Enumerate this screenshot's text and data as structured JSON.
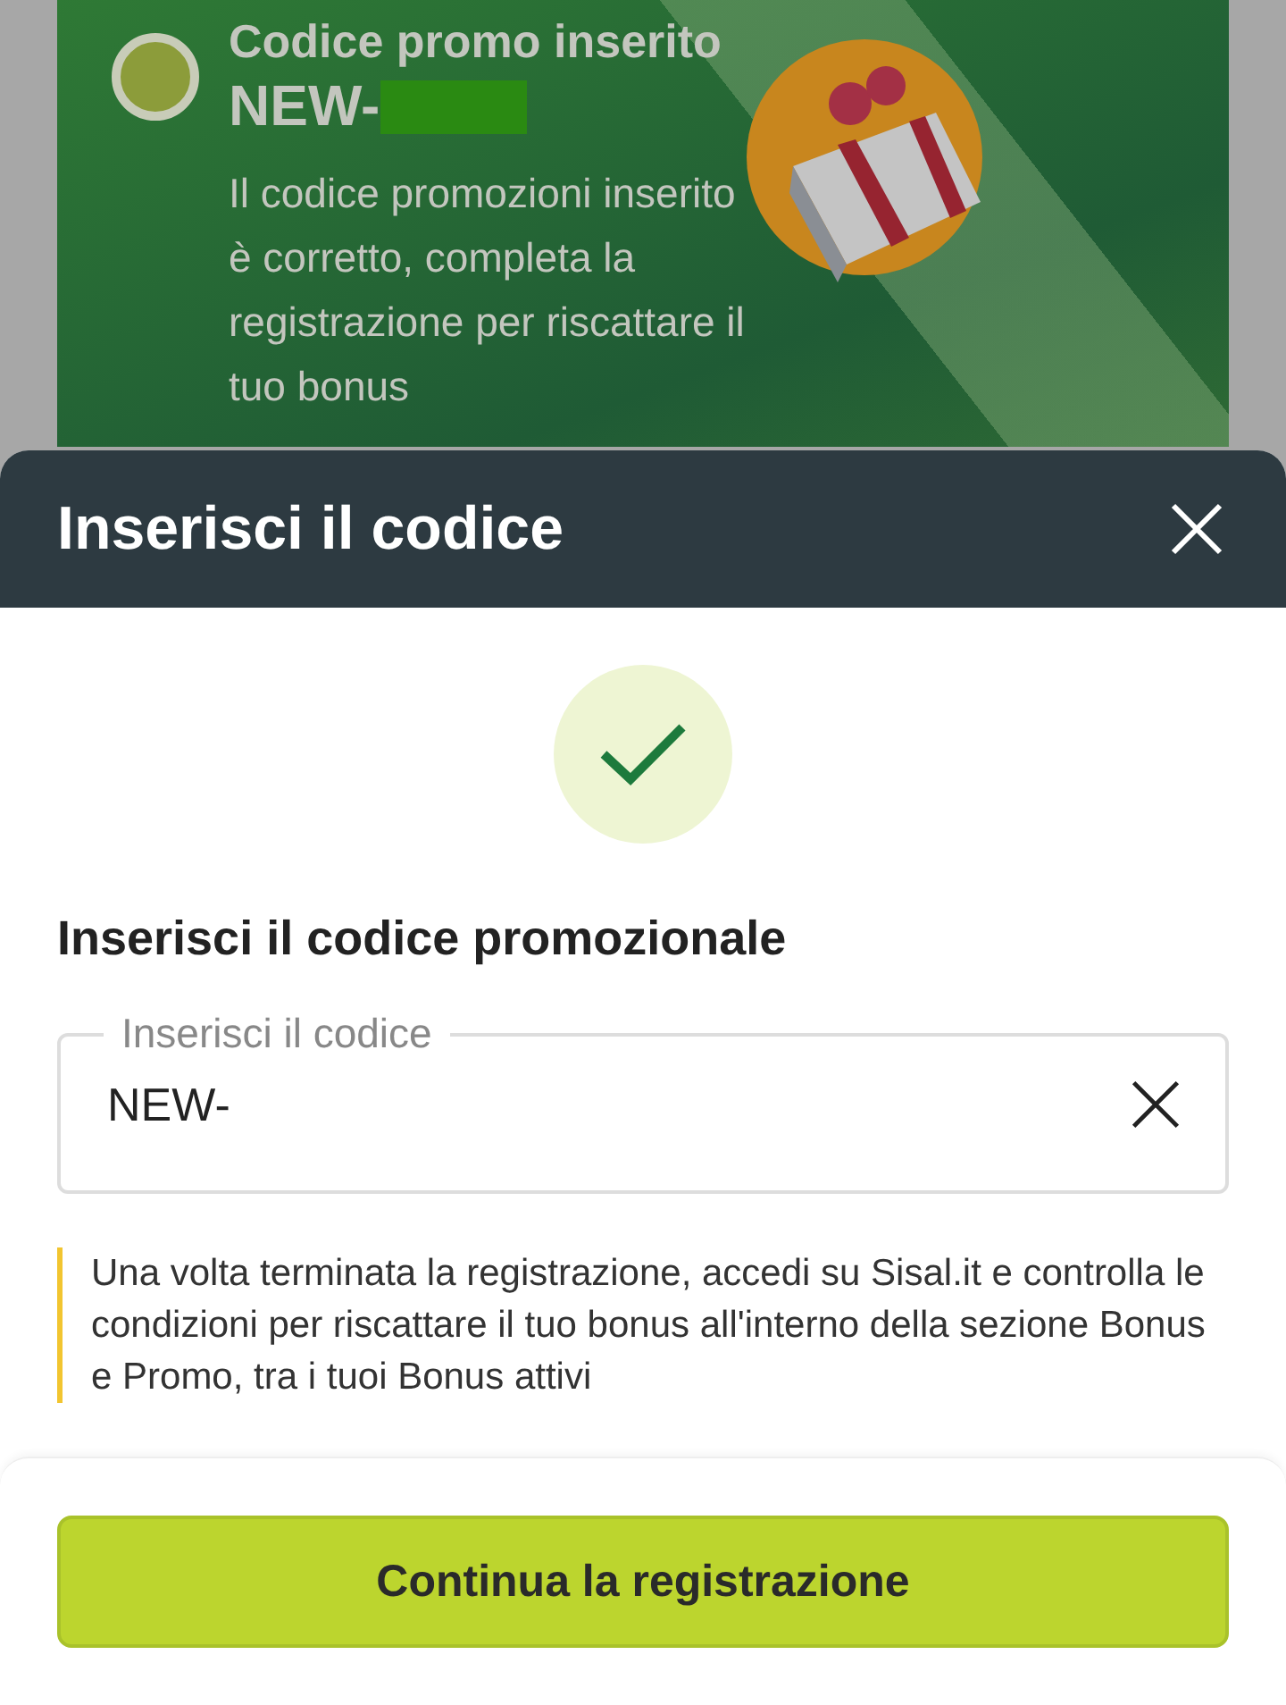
{
  "promo_card": {
    "title": "Codice promo inserito",
    "code": "NEW-",
    "message": "Il codice promozioni inserito è corretto, completa la registrazione per riscattare il tuo bonus"
  },
  "sheet": {
    "title": "Inserisci il codice",
    "heading": "Inserisci il codice promozionale",
    "field": {
      "label": "Inserisci il codice",
      "value": "NEW-"
    },
    "info": "Una volta terminata la registrazione, accedi su Sisal.it e controlla le condizioni per riscattare il tuo bonus all'interno della sezione Bonus e Promo, tra i tuoi Bonus attivi",
    "button": "Continua la registrazione"
  }
}
